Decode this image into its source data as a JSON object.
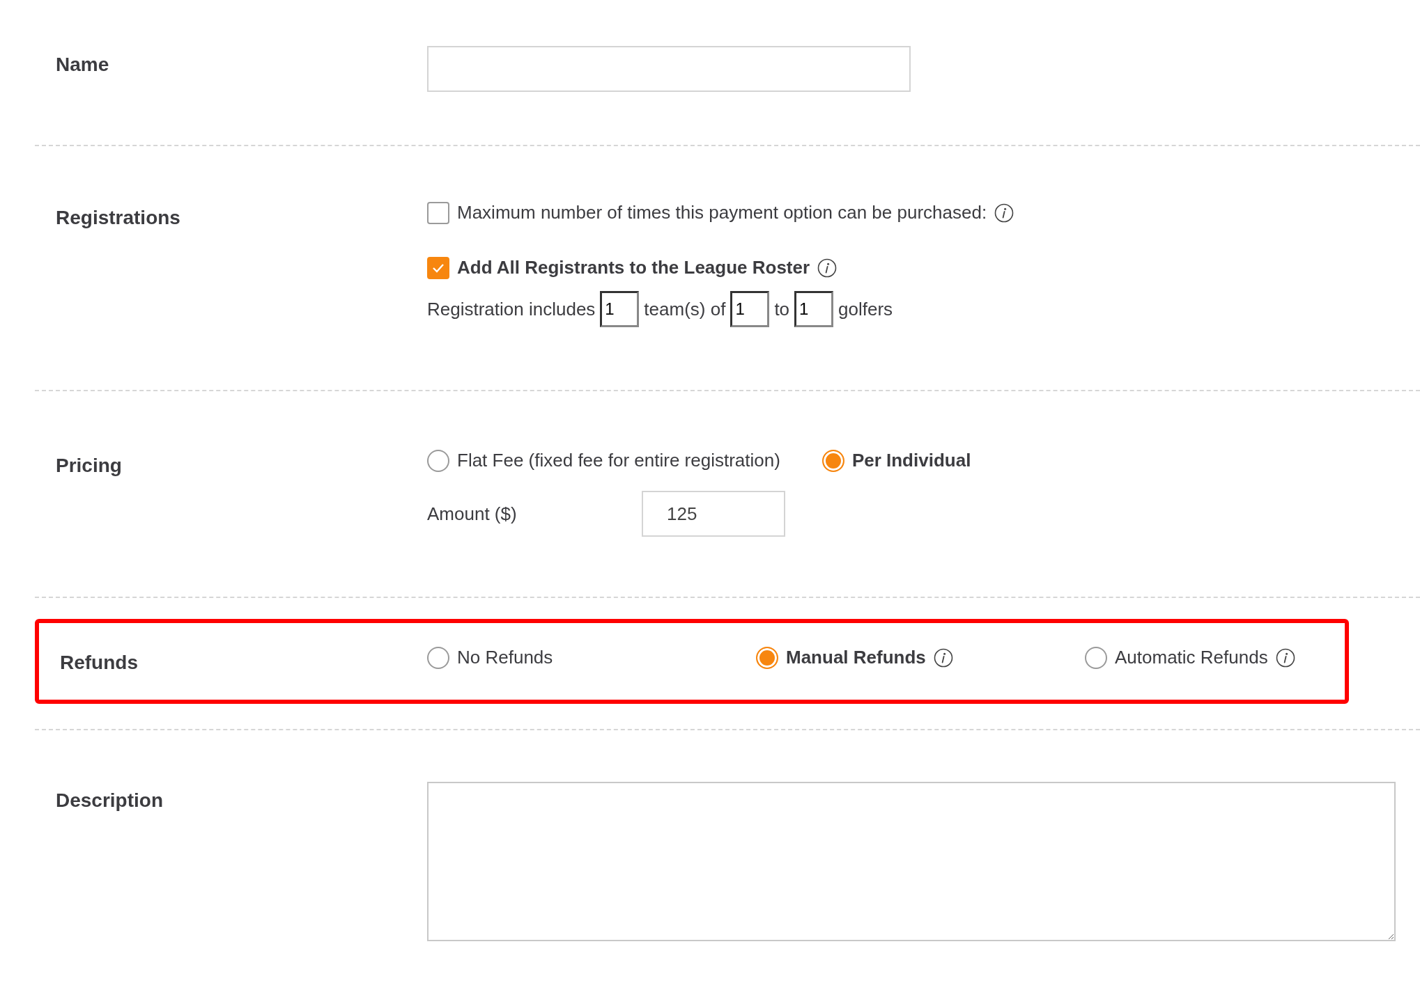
{
  "sections": [
    {
      "kind": "text",
      "label": "Name"
    },
    {
      "kind": "registrations",
      "label": "Registrations",
      "checks": [
        {
          "label": "Maximum number of times this payment option can be purchased:",
          "checked": false,
          "info": true
        },
        {
          "label": "Add All Registrants to the League Roster",
          "checked": true,
          "info": true
        }
      ],
      "includes": [
        {
          "kind": "text",
          "text": "Registration includes"
        },
        {
          "kind": "input",
          "value": "1"
        },
        {
          "kind": "text",
          "text": "team(s) of"
        },
        {
          "kind": "input",
          "value": "1"
        },
        {
          "kind": "text",
          "text": "to"
        },
        {
          "kind": "input",
          "value": "1"
        },
        {
          "kind": "text",
          "text": "golfers"
        }
      ]
    },
    {
      "kind": "pricing",
      "label": "Pricing",
      "options": [
        {
          "label": "Flat Fee (fixed fee for entire registration)",
          "selected": false
        },
        {
          "label": "Per Individual",
          "selected": true
        }
      ],
      "amount": {
        "label": "Amount ($)",
        "value": "125"
      }
    },
    {
      "kind": "refunds",
      "label": "Refunds",
      "highlighted": true,
      "options": [
        {
          "label": "No Refunds",
          "selected": false,
          "info": false
        },
        {
          "label": "Manual Refunds",
          "selected": true,
          "info": true
        },
        {
          "label": "Automatic Refunds",
          "selected": false,
          "info": true
        }
      ]
    },
    {
      "kind": "textarea",
      "label": "Description"
    }
  ]
}
